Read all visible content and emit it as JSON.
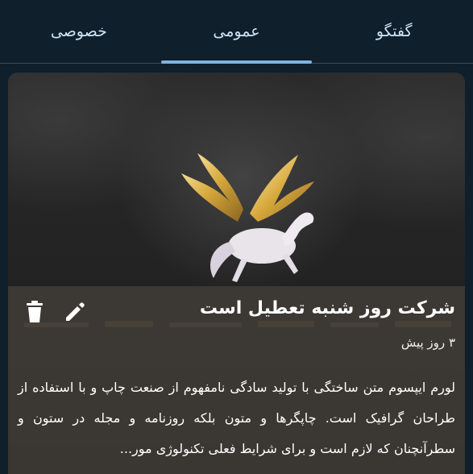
{
  "tabs": [
    {
      "label": "خصوصی",
      "active": false
    },
    {
      "label": "عمومی",
      "active": true
    },
    {
      "label": "گفتگو",
      "active": false
    }
  ],
  "post": {
    "title": "شرکت روز شنبه تعطیل است",
    "time": "۳ روز پیش",
    "body": "لورم ایپسوم متن ساختگی با تولید سادگی نامفهوم از صنعت چاپ و با استفاده از طراحان گرافیک است. چاپگرها و متون بلکه روزنامه و مجله در ستون و سطرآنچنان که لازم است و برای شرایط فعلی تکنولوژی مور..."
  },
  "icons": {
    "edit": "pencil-icon",
    "delete": "trash-icon"
  },
  "colors": {
    "background": "#0f1f2b",
    "tab_text": "#cfe3f4",
    "tab_indicator": "#7fb3da",
    "card_overlay": "#46413c"
  }
}
